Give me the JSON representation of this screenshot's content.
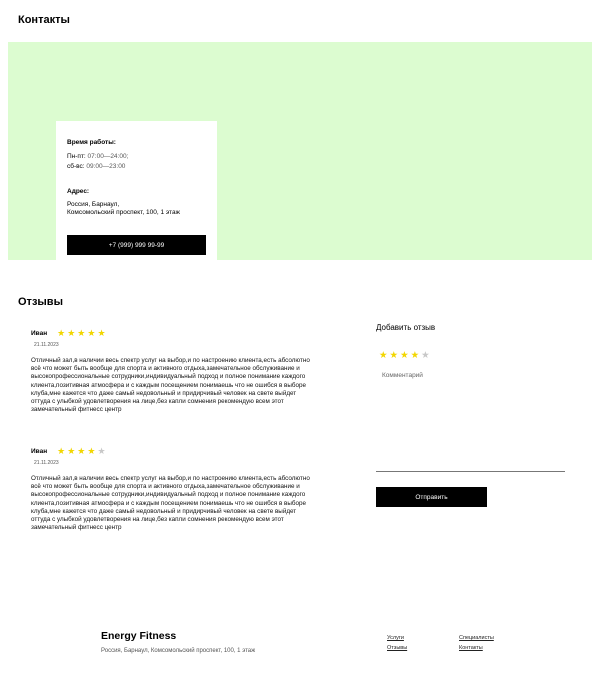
{
  "contacts": {
    "title": "Контакты",
    "hours_label": "Время работы:",
    "hours": [
      {
        "day": "Пн-пт:",
        "time": "07:00—24:00;"
      },
      {
        "day": "сб-вс:",
        "time": "09:00—23:00"
      }
    ],
    "address_label": "Адрес:",
    "address_lines": [
      "Россия, Барнаул,",
      "Комсомольский проспект, 100, 1 этаж"
    ],
    "phone": "+7 (999) 999 99-99",
    "map_color": "#dcfcd0"
  },
  "reviews": {
    "title": "Отзывы",
    "items": [
      {
        "author": "Иван",
        "rating": 5,
        "date": "21.11.2023",
        "text": "Отличный зал,в наличии весь спектр услуг на выбор,и по настроению клиента,есть абсолютно всё что может быть вообще для спорта и активного отдыха,замечательное обслуживание и высокопрофессиональные сотрудники,индивидуальный подход и полное понимание каждого клиента,позитивная атмосфера и с каждым посещением понимаешь что не ошибся в выборе клуба,мне кажется что даже самый недовольный и придирчивый человек на свете выйдет оттуда с улыбкой удовлетворения на лице,без капли сомнения рекомендую всем этот замечательный фитнесс центр"
      },
      {
        "author": "Иван",
        "rating": 4,
        "date": "21.11.2023",
        "text": "Отличный зал,в наличии весь спектр услуг на выбор,и по настроению клиента,есть абсолютно всё что может быть вообще для спорта и активного отдыха,замечательное обслуживание и высокопрофессиональные сотрудники,индивидуальный подход и полное понимание каждого клиента,позитивная атмосфера и с каждым посещением понимаешь что не ошибся в выборе клуба,мне кажется что даже самый недовольный и придирчивый человек на свете выйдет оттуда с улыбкой удовлетворения на лице,без капли сомнения рекомендую всем этот замечательный фитнесс центр"
      }
    ]
  },
  "add_review": {
    "title": "Добавить отзыв",
    "rating": 4,
    "comment_placeholder": "Комментарий",
    "submit_label": "Отправить"
  },
  "footer": {
    "brand": "Energy Fitness",
    "address": "Россия, Барнаул, Комсомольский проспект, 100, 1 этаж",
    "links": [
      "Услуги",
      "Отзывы",
      "Специалисты",
      "Контакты"
    ]
  },
  "colors": {
    "star_active": "#f2d600",
    "star_inactive": "#c8c8c8",
    "button_bg": "#000000"
  }
}
